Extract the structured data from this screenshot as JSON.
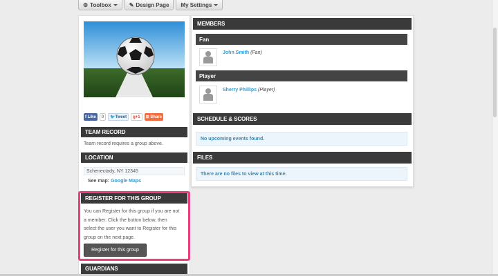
{
  "toolbar": {
    "toolbox": "Toolbox",
    "design_page": "Design Page",
    "my_settings": "My Settings"
  },
  "social": {
    "like": "Like",
    "like_count": "0",
    "tweet": "Tweet",
    "gplus": "g+1",
    "share": "Share"
  },
  "team_record": {
    "header": "TEAM RECORD",
    "text": "Team record requires a group above."
  },
  "location": {
    "header": "LOCATION",
    "address": "Schenectady, NY 12345",
    "see_map_label": "See map:",
    "map_link": "Google Maps"
  },
  "register": {
    "header": "REGISTER FOR THIS GROUP",
    "line1": "You can Register for this group if you are not",
    "line2": "a member. Click the button below, then",
    "line3": "select the user you want to Register for this",
    "line4": "group on the next page.",
    "button": "Register for this group"
  },
  "guardians": {
    "header": "GUARDIANS"
  },
  "members": {
    "header": "MEMBERS",
    "groups": [
      {
        "title": "Fan",
        "name": "John Smith",
        "role": "(Fan)"
      },
      {
        "title": "Player",
        "name": "Sherry Phillips",
        "role": "(Player)"
      }
    ]
  },
  "schedule": {
    "header": "SCHEDULE & SCORES",
    "empty": "No upcoming events found."
  },
  "files": {
    "header": "FILES",
    "empty": "There are no files to view at this time."
  },
  "colors": {
    "header_bg": "#3a3a3a",
    "link": "#2a9fd6",
    "highlight": "#e8407e",
    "info_text": "#3a87ad"
  }
}
